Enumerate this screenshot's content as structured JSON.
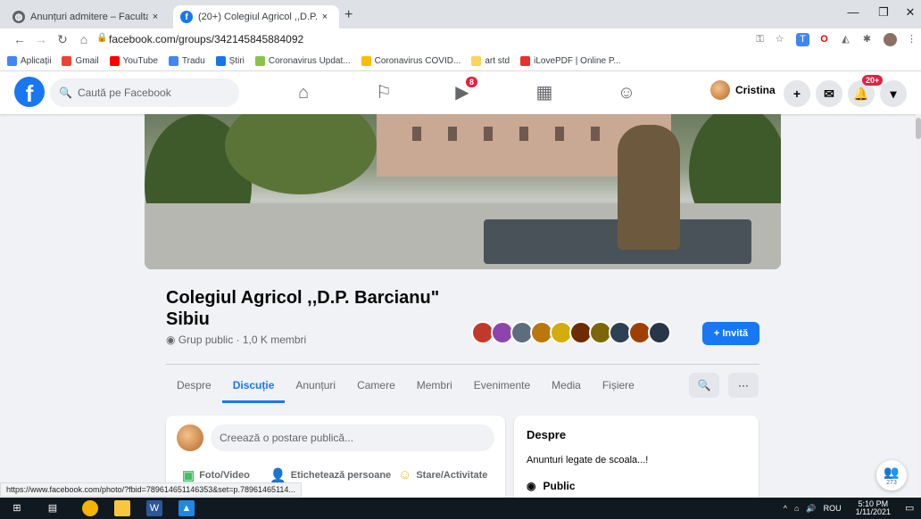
{
  "browser": {
    "tabs": [
      {
        "title": "Anunțuri admitere – Facultatea de",
        "close": "×"
      },
      {
        "title": "(20+) Colegiul Agricol ,,D.P. Barcia",
        "close": "×"
      }
    ],
    "new_tab": "+",
    "window_controls": {
      "minimize": "—",
      "restore": "❐",
      "close": "✕"
    },
    "url": "facebook.com/groups/342145845884092",
    "bookmarks": [
      {
        "label": "Aplicații",
        "color": "#4285f4"
      },
      {
        "label": "Gmail",
        "color": "#ea4335"
      },
      {
        "label": "YouTube",
        "color": "#ff0000"
      },
      {
        "label": "Tradu",
        "color": "#4285f4"
      },
      {
        "label": "Știri",
        "color": "#1a73e8"
      },
      {
        "label": "Coronavirus Updat...",
        "color": "#8bc34a"
      },
      {
        "label": "Coronavirus COVID...",
        "color": "#fbbc04"
      },
      {
        "label": "art std",
        "color": "#f9d65b"
      },
      {
        "label": "iLovePDF | Online P...",
        "color": "#e5322d"
      }
    ],
    "status_url": "https://www.facebook.com/photo/?fbid=789614651146353&set=p.78961465114..."
  },
  "facebook": {
    "logo": "f",
    "search_placeholder": "Caută pe Facebook",
    "video_badge": "8",
    "user_name": "Cristina",
    "notifications_badge": "20+",
    "create_label": "+"
  },
  "group": {
    "name": "Colegiul Agricol ,,D.P. Barcianu\" Sibiu",
    "meta": "Grup public · 1,0 K membri",
    "invite_label": "+ Invită",
    "member_colors": [
      "#c0392b",
      "#8e44ad",
      "#5d6d7e",
      "#b9770e",
      "#d4ac0d",
      "#6e2c00",
      "#7d6608",
      "#2e4053",
      "#a04000",
      "#283747"
    ],
    "tabs": [
      "Despre",
      "Discuție",
      "Anunțuri",
      "Camere",
      "Membri",
      "Evenimente",
      "Media",
      "Fișiere"
    ],
    "active_tab": "Discuție",
    "search_btn": "🔍",
    "more_btn": "···"
  },
  "composer": {
    "placeholder": "Creează o postare publică...",
    "actions": [
      {
        "label": "Foto/Video",
        "icon": "photo-icon",
        "color": "#45bd62"
      },
      {
        "label": "Etichetează persoane",
        "icon": "tag-people-icon",
        "color": "#1877f2"
      },
      {
        "label": "Stare/Activitate",
        "icon": "smiley-icon",
        "color": "#f7b928"
      }
    ]
  },
  "about": {
    "heading": "Despre",
    "description": "Anunturi legate de scoala...!",
    "privacy": "Public"
  },
  "floating": {
    "count": "273"
  },
  "taskbar": {
    "lang": "ROU",
    "time": "5:10 PM",
    "date": "1/11/2021"
  },
  "colors": {
    "fb_blue": "#1877f2",
    "fb_bg": "#f0f2f5"
  }
}
